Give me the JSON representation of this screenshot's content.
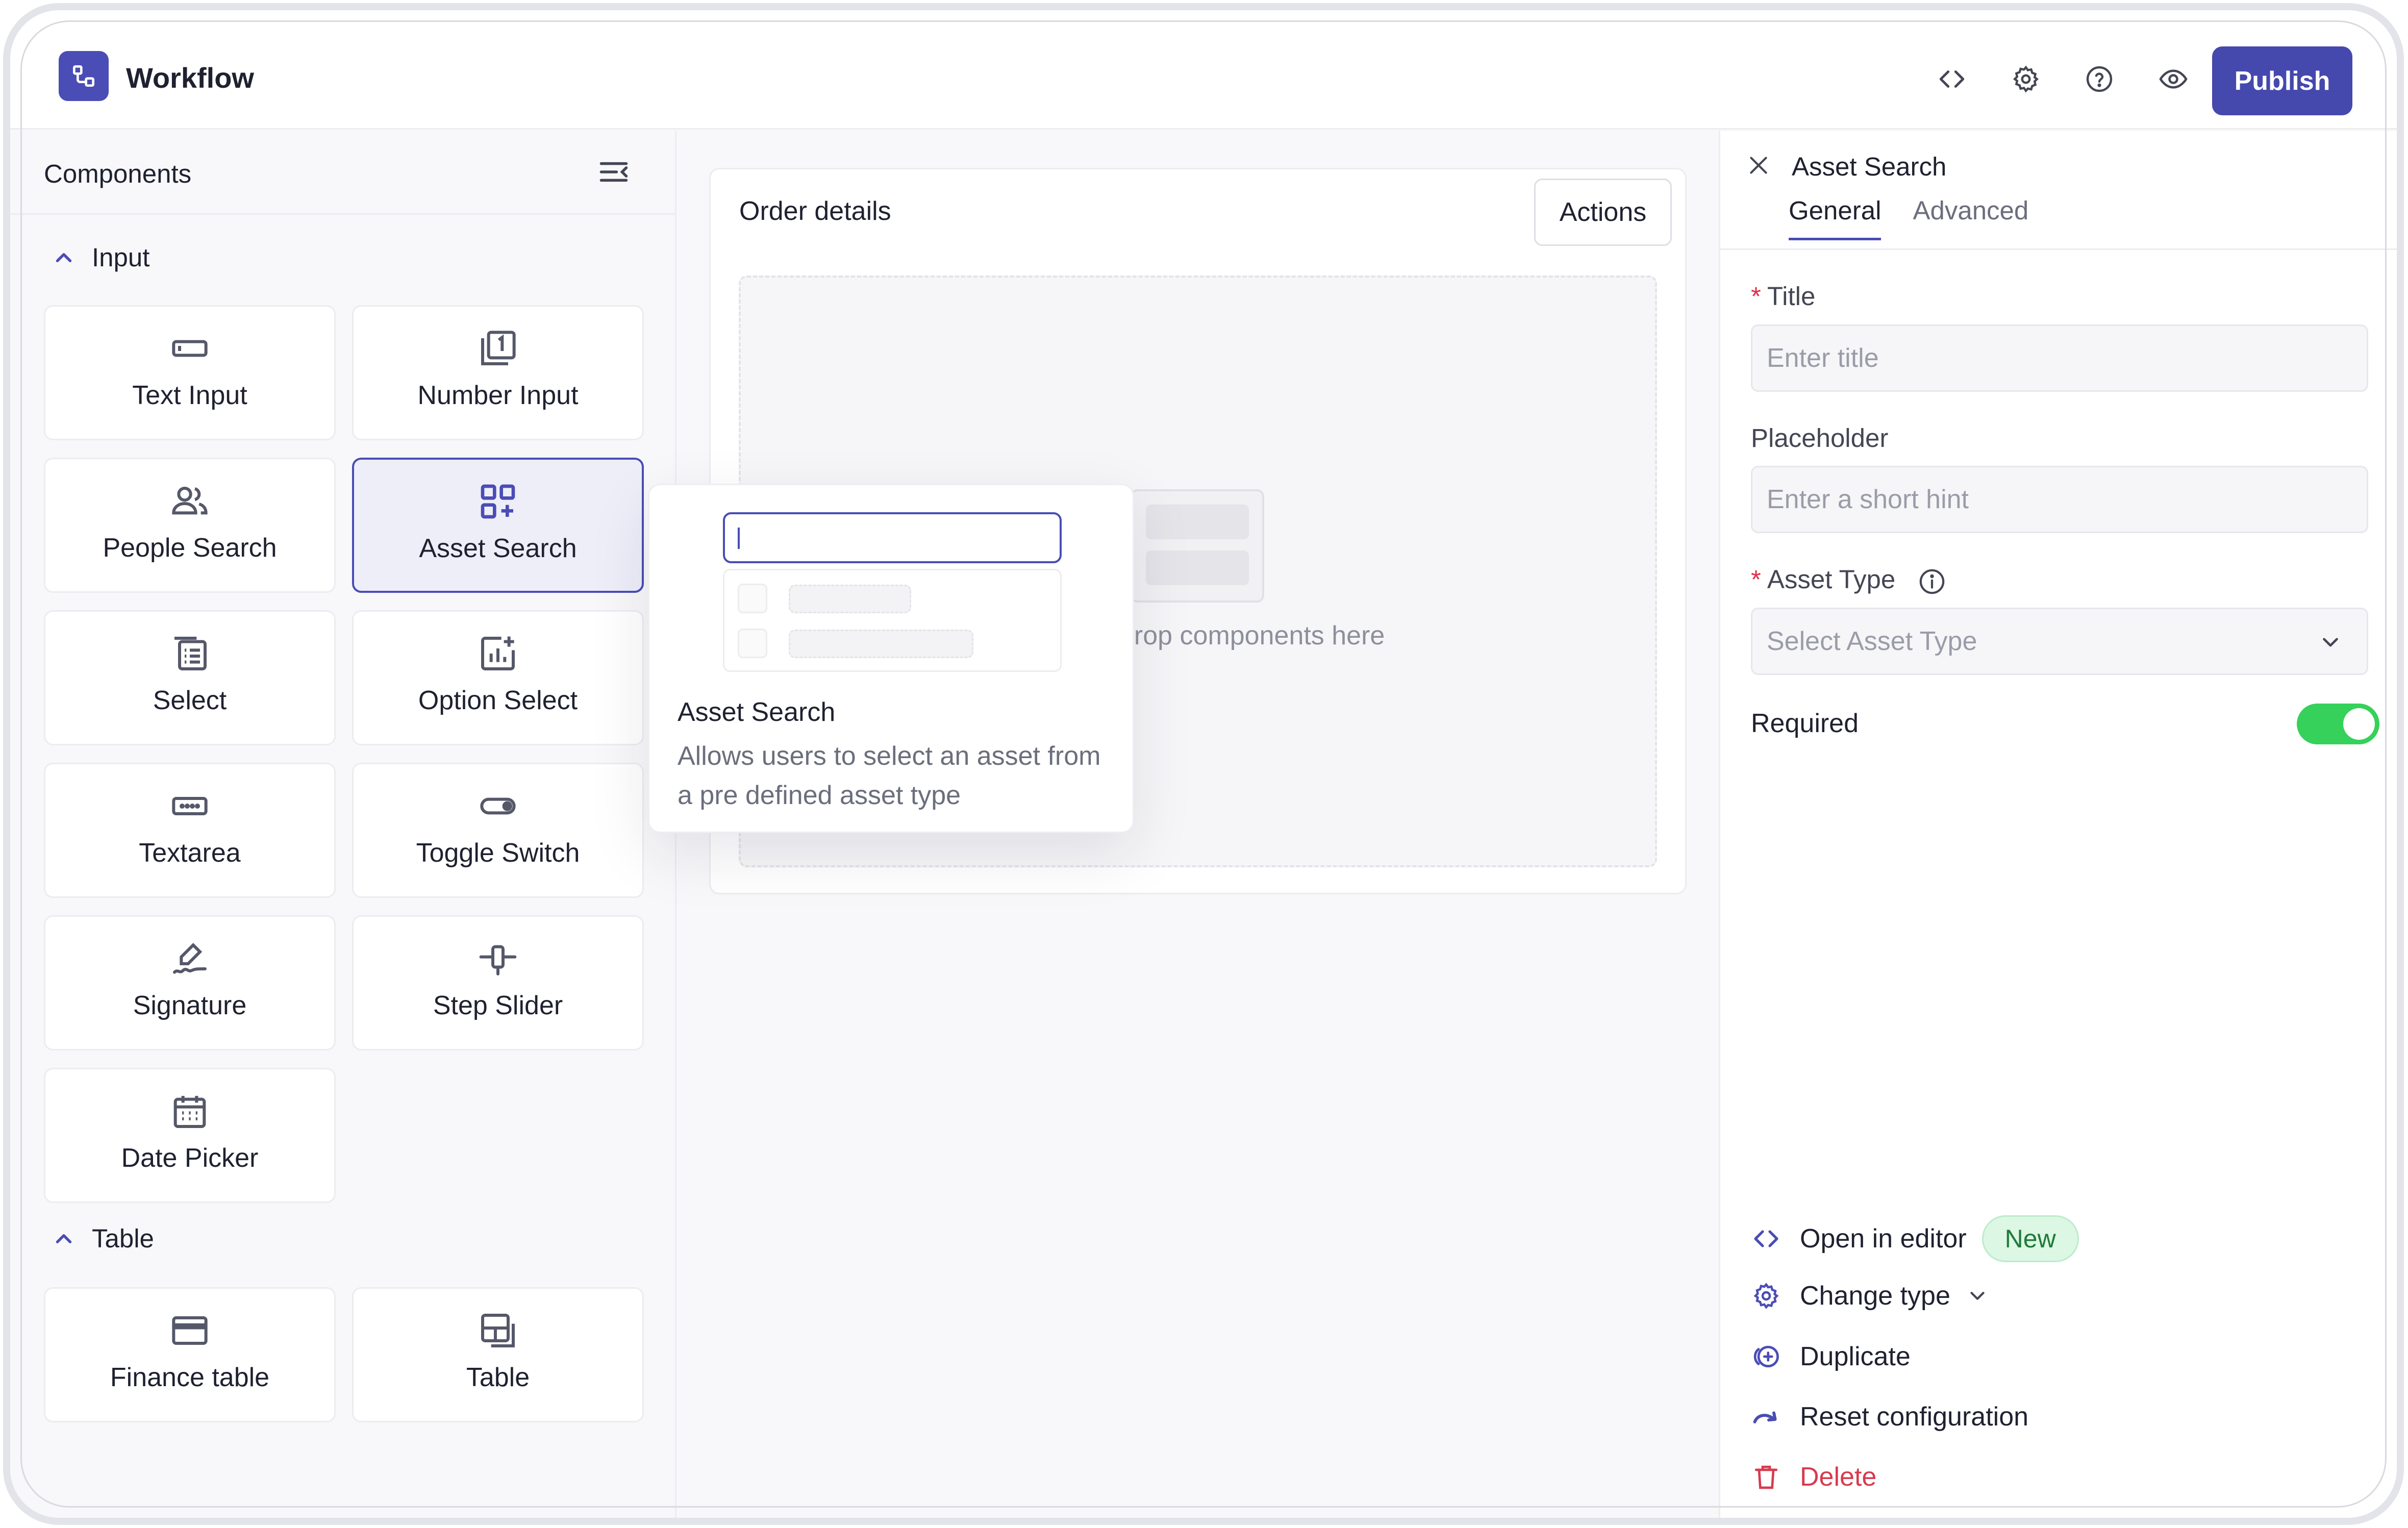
{
  "header": {
    "app_title": "Workflow",
    "icons": [
      "code-icon",
      "gear-icon",
      "help-icon",
      "eye-icon"
    ],
    "publish_label": "Publish",
    "accent_color": "#4548ad"
  },
  "components": {
    "title": "Components",
    "sections": [
      {
        "label": "Input",
        "items": [
          {
            "label": "Text Input",
            "icon": "text-input-icon"
          },
          {
            "label": "Number Input",
            "icon": "number-input-icon"
          },
          {
            "label": "People Search",
            "icon": "people-icon"
          },
          {
            "label": "Asset Search",
            "icon": "asset-search-icon",
            "active": true
          },
          {
            "label": "Select",
            "icon": "select-icon"
          },
          {
            "label": "Option Select",
            "icon": "option-select-icon"
          },
          {
            "label": "Textarea",
            "icon": "textarea-icon"
          },
          {
            "label": "Toggle Switch",
            "icon": "toggle-icon"
          },
          {
            "label": "Signature",
            "icon": "signature-icon"
          },
          {
            "label": "Step Slider",
            "icon": "slider-icon"
          },
          {
            "label": "Date Picker",
            "icon": "calendar-icon"
          }
        ]
      },
      {
        "label": "Table",
        "items": [
          {
            "label": "Finance table",
            "icon": "finance-table-icon"
          },
          {
            "label": "Table",
            "icon": "table-icon"
          }
        ]
      }
    ]
  },
  "canvas": {
    "card_title": "Order details",
    "actions_label": "Actions",
    "drop_text": "drop components here"
  },
  "tooltip": {
    "title": "Asset Search",
    "description": "Allows users to select an asset from a pre defined asset type"
  },
  "properties": {
    "title": "Asset Search",
    "tabs": [
      {
        "label": "General",
        "active": true
      },
      {
        "label": "Advanced",
        "active": false
      }
    ],
    "fields": {
      "title_label": "Title",
      "title_placeholder": "Enter title",
      "placeholder_label": "Placeholder",
      "placeholder_placeholder": "Enter a short hint",
      "asset_type_label": "Asset Type",
      "asset_type_placeholder": "Select Asset Type",
      "required_label": "Required",
      "required_value": true
    },
    "actions": {
      "open_editor": "Open in editor",
      "new_badge": "New",
      "change_type": "Change type",
      "duplicate": "Duplicate",
      "reset": "Reset configuration",
      "delete": "Delete"
    },
    "toggle_color": "#35d15a",
    "danger_color": "#d73a4f"
  }
}
